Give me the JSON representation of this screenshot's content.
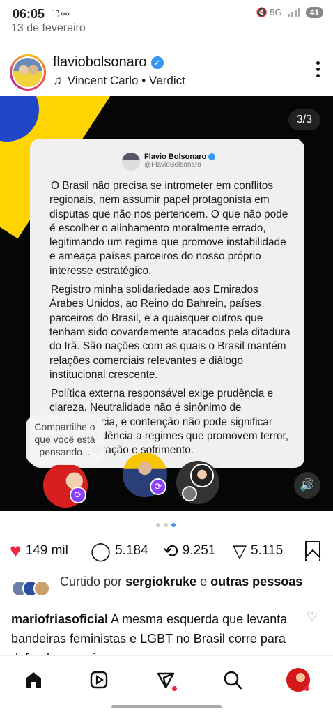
{
  "status_bar": {
    "time": "06:05",
    "date": "13 de fevereiro",
    "battery": "41",
    "left_icons": "⛶ ⚯",
    "right_icons": "🔇 5G"
  },
  "post": {
    "username": "flaviobolsonaro",
    "verified_mark": "✓",
    "audio_label": "Vincent Carlo • Verdict",
    "slide_counter": "3/3",
    "tweet": {
      "author": "Flavio Bolsonaro",
      "handle": "@FlavioBolsonaro",
      "paragraphs": [
        "O Brasil não precisa se intrometer em conflitos regionais, nem assumir papel protagonista em disputas que não nos pertencem. O que não pode é escolher o alinhamento moralmente errado, legitimando um regime que promove instabilidade e ameaça países parceiros do nosso próprio interesse estratégico.",
        "Registro minha solidariedade aos Emirados Árabes Unidos, ao Reino do Bahrein, países parceiros do Brasil, e a quaisquer outros que tenham sido covardemente atacados pela ditadura do Irã. São nações com as quais o Brasil mantém relações comerciais relevantes e diálogo institucional crescente.",
        "Política externa responsável exige prudência e clareza. Neutralidade não é sinônimo de complacência, e contenção não pode significar condescendência a regimes que promovem terror, desestabilização e sofrimento."
      ]
    },
    "share_bubble": "Compartilhe o que você está pensando...",
    "carousel": {
      "count": 3,
      "active_index": 2
    },
    "stats": {
      "likes": "149 mil",
      "comments": "5.184",
      "reposts": "9.251",
      "shares": "5.115"
    },
    "liked_by": {
      "prefix": "Curtido por",
      "user": "sergiokruke",
      "joiner": "e",
      "others": "outras pessoas"
    },
    "caption": {
      "user": "mariofriasoficial",
      "text": "A mesma esquerda que levanta bandeiras feministas e LGBT no Brasil corre para defender o regime"
    }
  },
  "icons": {
    "heart": "heart-icon",
    "comment": "comment-icon",
    "repost": "repost-icon",
    "share": "send-icon",
    "bookmark": "bookmark-icon",
    "home": "home-icon",
    "reels": "reels-icon",
    "direct": "direct-icon",
    "search": "search-icon",
    "mute": "mute-icon",
    "music": "music-note-icon"
  },
  "colors": {
    "like_red": "#ed2741",
    "verified_blue": "#3897f0",
    "repost_purple": "#8a3ffc",
    "flag_yellow": "#ffd400",
    "flag_blue": "#1f47c8"
  }
}
